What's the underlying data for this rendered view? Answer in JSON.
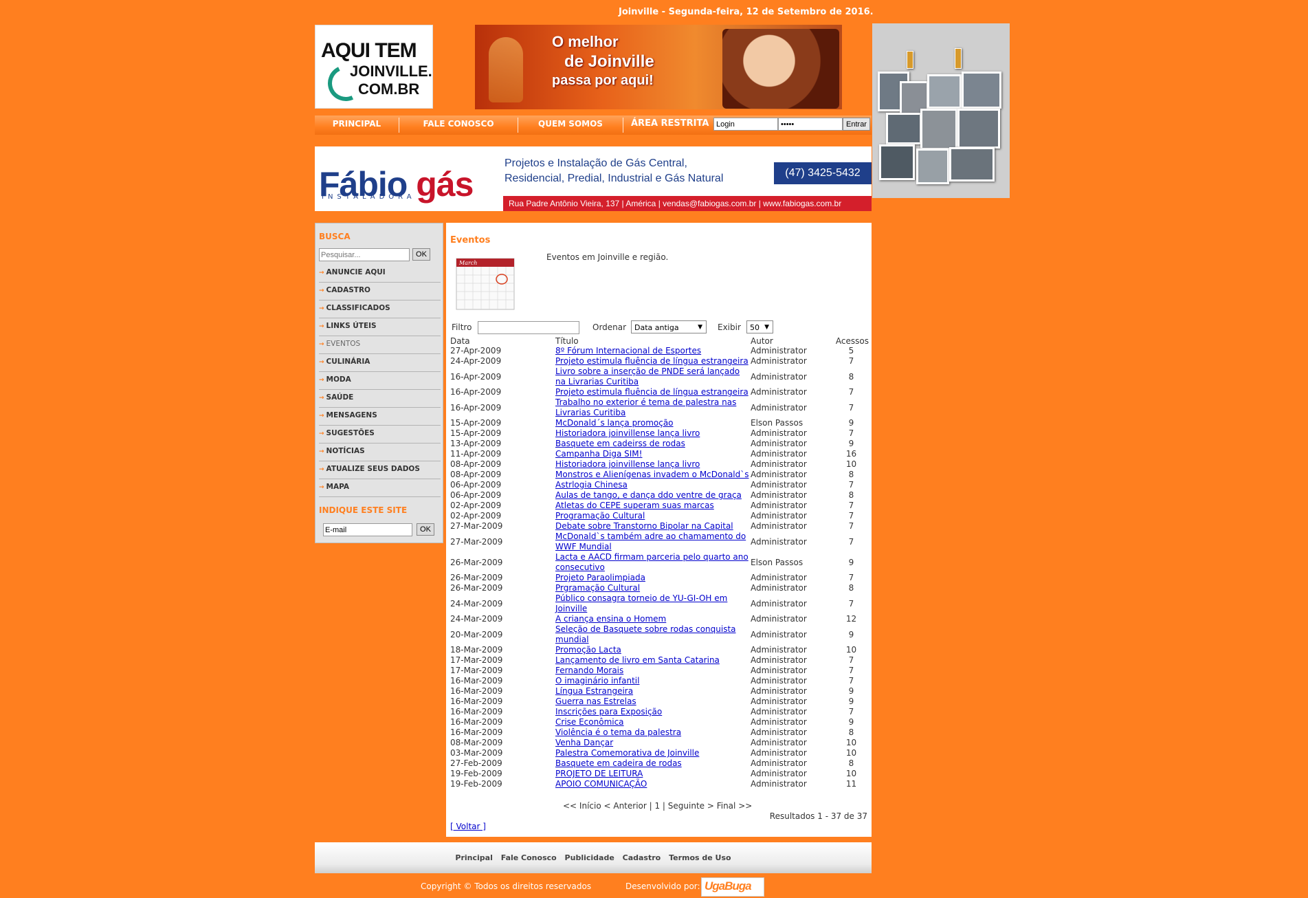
{
  "header": {
    "date_line": "Joinville - Segunda-feira, 12 de Setembro de 2016.",
    "logo_line1": "AQUI TEM",
    "logo_line2": "JOINVILLE.",
    "logo_line3": "COM.BR",
    "banner_line1": "O melhor",
    "banner_line2": "de Joinville",
    "banner_line3": "passa por aqui!"
  },
  "nav": {
    "items": [
      "PRINCIPAL",
      "FALE CONOSCO",
      "QUEM SOMOS"
    ],
    "restrita_label": "ÁREA RESTRITA",
    "login_value": "Login",
    "password_value": "•••••",
    "entrar_label": "Entrar"
  },
  "ad": {
    "name_part1": "Fábio ",
    "name_part2": "gás",
    "subtitle": "INSTALADORA",
    "desc_line1": "Projetos e Instalação de Gás Central,",
    "desc_line2": "Residencial, Predial, Industrial e Gás Natural",
    "phone": "(47) 3425-5432",
    "address": "Rua Padre Antônio Vieira, 137 | América | vendas@fabiogas.com.br | www.fabiogas.com.br"
  },
  "sidebar": {
    "busca_title": "BUSCA",
    "busca_placeholder": "Pesquisar...",
    "ok_label": "OK",
    "items": [
      {
        "label": "ANUNCIE AQUI"
      },
      {
        "label": "CADASTRO"
      },
      {
        "label": "CLASSIFICADOS"
      },
      {
        "label": "LINKS ÚTEIS"
      },
      {
        "label": "EVENTOS"
      },
      {
        "label": "CULINÁRIA"
      },
      {
        "label": "MODA"
      },
      {
        "label": "SAÚDE"
      },
      {
        "label": "MENSAGENS"
      },
      {
        "label": "SUGESTÕES"
      },
      {
        "label": "NOTÍCIAS"
      },
      {
        "label": "ATUALIZE SEUS DADOS"
      },
      {
        "label": "MAPA"
      }
    ],
    "indique_title": "INDIQUE ESTE SITE",
    "email_value": "E-mail"
  },
  "main": {
    "title": "Eventos",
    "intro": "Eventos em Joinville e região.",
    "calendar_month": "March",
    "filtro_label": "Filtro",
    "ordenar_label": "Ordenar",
    "ordenar_value": "Data antiga",
    "exibir_label": "Exibir",
    "exibir_value": "50",
    "columns": [
      "Data",
      "Título",
      "Autor",
      "Acessos"
    ],
    "rows": [
      [
        "27-Apr-2009",
        "8º Fórum Internacional de Esportes",
        "Administrator",
        "5"
      ],
      [
        "24-Apr-2009",
        "Projeto estimula fluência de língua estrangeira",
        "Administrator",
        "7"
      ],
      [
        "16-Apr-2009",
        "Livro sobre a inserção de PNDE será lançado na Livrarias Curitiba",
        "Administrator",
        "8"
      ],
      [
        "16-Apr-2009",
        "Projeto estimula fluência de língua estrangeira",
        "Administrator",
        "7"
      ],
      [
        "16-Apr-2009",
        "Trabalho no exterior é tema de palestra nas Livrarias Curitiba",
        "Administrator",
        "7"
      ],
      [
        "15-Apr-2009",
        "McDonald´s lança promoção",
        "Elson Passos",
        "9"
      ],
      [
        "15-Apr-2009",
        "Historiadora joinvillense lança livro",
        "Administrator",
        "7"
      ],
      [
        "13-Apr-2009",
        "Basquete em cadeirss de rodas",
        "Administrator",
        "9"
      ],
      [
        "11-Apr-2009",
        "Campanha Diga SIM!",
        "Administrator",
        "16"
      ],
      [
        "08-Apr-2009",
        "Historiadora joinvillense lança livro",
        "Administrator",
        "10"
      ],
      [
        "08-Apr-2009",
        "Monstros e Alienígenas invadem o McDonald`s",
        "Administrator",
        "8"
      ],
      [
        "06-Apr-2009",
        "Astrlogia Chinesa",
        "Administrator",
        "7"
      ],
      [
        "06-Apr-2009",
        "Aulas de tango, e dança ddo ventre de graça",
        "Administrator",
        "8"
      ],
      [
        "02-Apr-2009",
        "Atletas do CEPE superam suas marcas",
        "Administrator",
        "7"
      ],
      [
        "02-Apr-2009",
        "Programação Cultural",
        "Administrator",
        "7"
      ],
      [
        "27-Mar-2009",
        "Debate sobre Transtorno Bipolar na Capital",
        "Administrator",
        "7"
      ],
      [
        "27-Mar-2009",
        "McDonald`s também adre ao chamamento do WWF Mundial",
        "Administrator",
        "7"
      ],
      [
        "26-Mar-2009",
        "Lacta e AACD firmam parceria pelo quarto ano consecutivo",
        "Elson Passos",
        "9"
      ],
      [
        "26-Mar-2009",
        "Projeto Paraolimpiada",
        "Administrator",
        "7"
      ],
      [
        "26-Mar-2009",
        "Prgramação Cultural",
        "Administrator",
        "8"
      ],
      [
        "24-Mar-2009",
        "Público consagra torneio de YU-GI-OH em Joinville",
        "Administrator",
        "7"
      ],
      [
        "24-Mar-2009",
        "A criança ensina o Homem",
        "Administrator",
        "12"
      ],
      [
        "20-Mar-2009",
        "Seleção de Basquete sobre rodas conquista mundial",
        "Administrator",
        "9"
      ],
      [
        "18-Mar-2009",
        "Promoção Lacta",
        "Administrator",
        "10"
      ],
      [
        "17-Mar-2009",
        "Lançamento de livro em Santa Catarina",
        "Administrator",
        "7"
      ],
      [
        "17-Mar-2009",
        "Fernando Morais",
        "Administrator",
        "7"
      ],
      [
        "16-Mar-2009",
        "O imaginário infantil",
        "Administrator",
        "7"
      ],
      [
        "16-Mar-2009",
        "Língua Estrangeira",
        "Administrator",
        "9"
      ],
      [
        "16-Mar-2009",
        "Guerra nas Estrelas",
        "Administrator",
        "9"
      ],
      [
        "16-Mar-2009",
        "Inscrições para Exposição",
        "Administrator",
        "7"
      ],
      [
        "16-Mar-2009",
        "Crise Econômica",
        "Administrator",
        "9"
      ],
      [
        "16-Mar-2009",
        "Violência é o tema da palestra",
        "Administrator",
        "8"
      ],
      [
        "08-Mar-2009",
        "Venha Dançar",
        "Administrator",
        "10"
      ],
      [
        "03-Mar-2009",
        "Palestra Comemorativa de Joinville",
        "Administrator",
        "10"
      ],
      [
        "27-Feb-2009",
        "Basquete em cadeira de rodas",
        "Administrator",
        "8"
      ],
      [
        "19-Feb-2009",
        "PROJETO DE LEITURA",
        "Administrator",
        "10"
      ],
      [
        "19-Feb-2009",
        "APOIO COMUNICAÇÃO",
        "Administrator",
        "11"
      ]
    ],
    "pagination": "<< Início < Anterior | 1 | Seguinte > Final >>",
    "results": "Resultados 1 - 37 de 37",
    "voltar": "[ Voltar ]"
  },
  "footer": {
    "links": [
      "Principal",
      "Fale Conosco",
      "Publicidade",
      "Cadastro",
      "Termos de Uso"
    ],
    "copyright": "Copyright © Todos os direitos reservados",
    "developed_by": "Desenvolvido por:",
    "developer_logo": "UgaBuga"
  },
  "colors": {
    "background": "#FF7F1F",
    "link": "#0000CC",
    "ad_blue": "#1F3F8A",
    "ad_red": "#D41F2B"
  }
}
